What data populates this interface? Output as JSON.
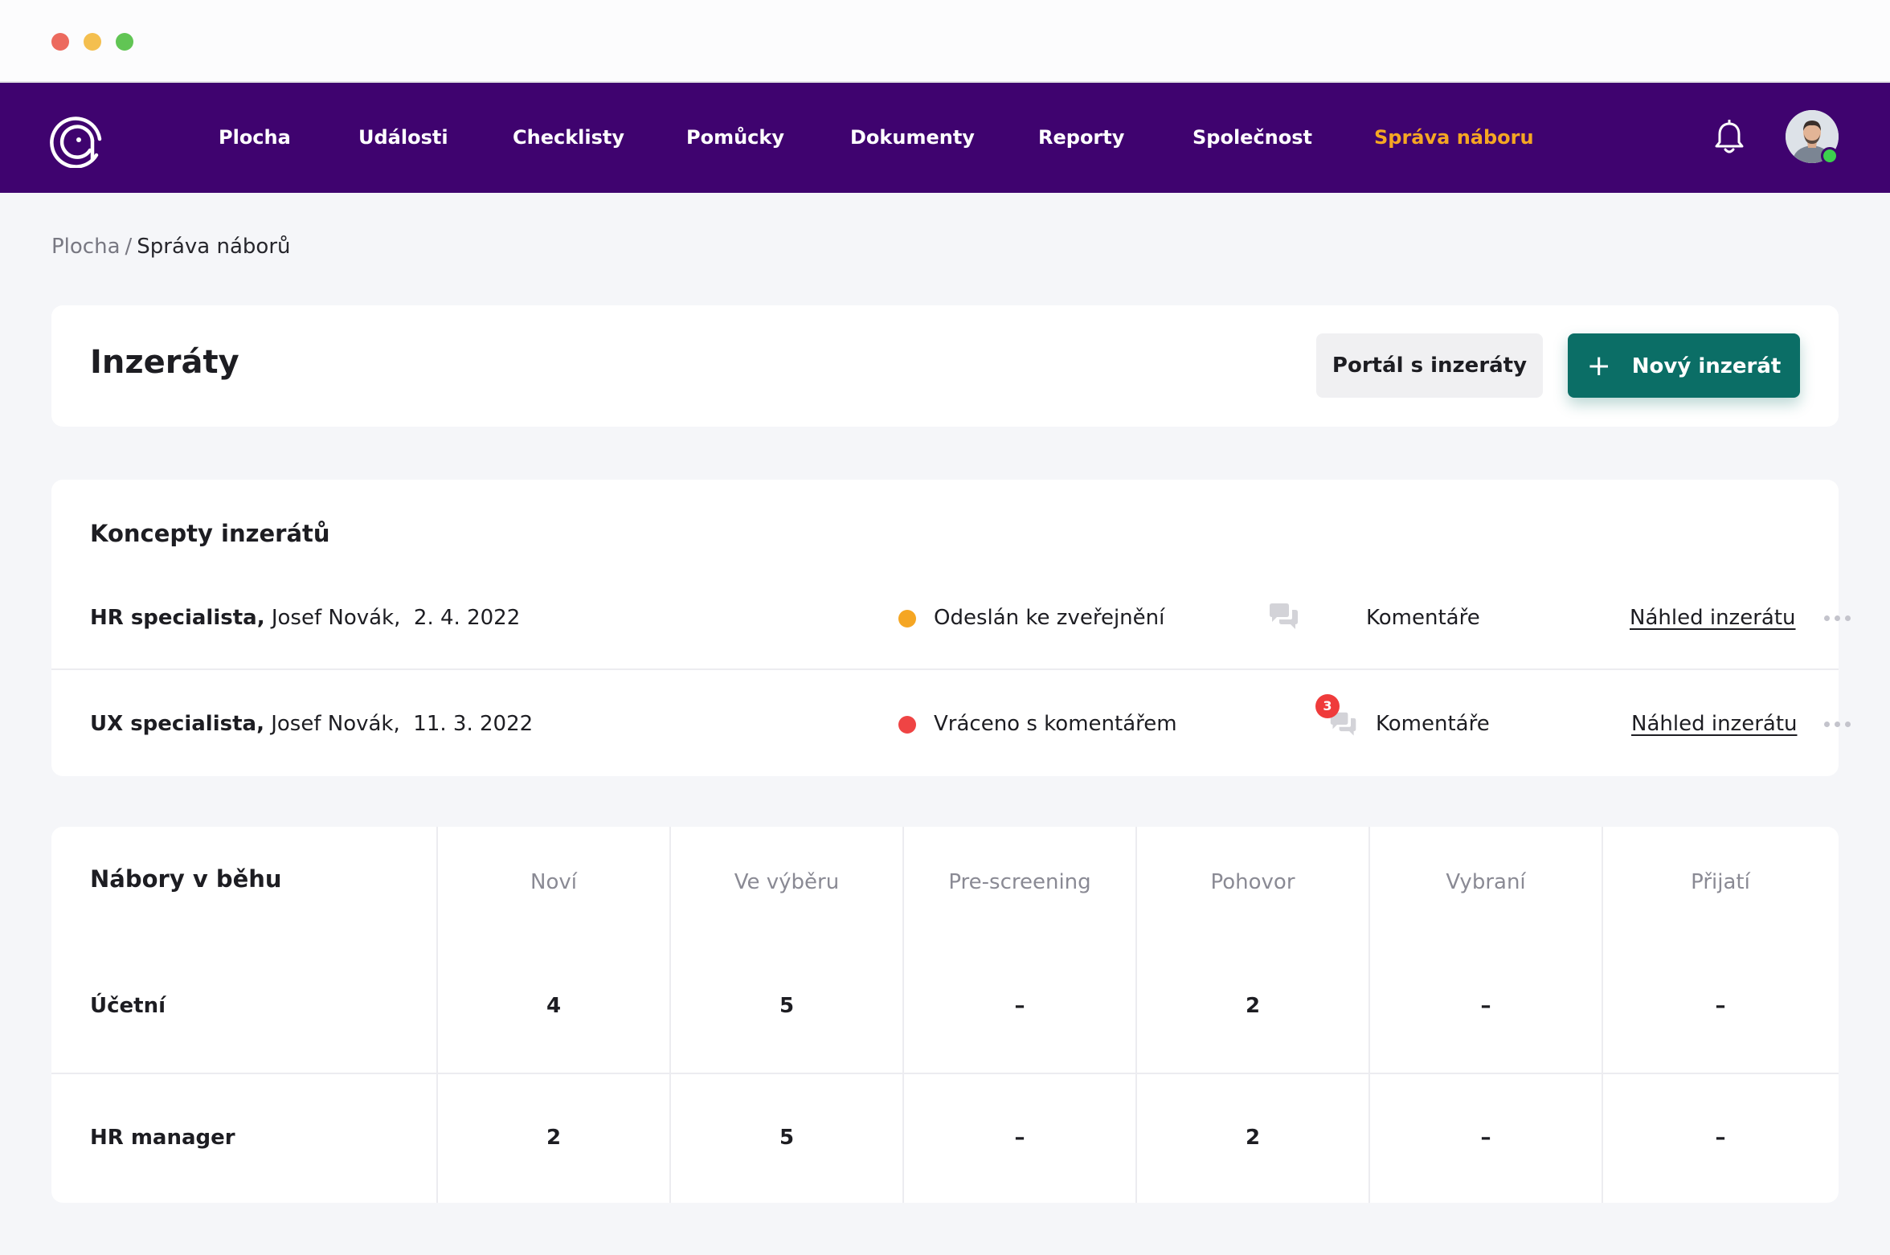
{
  "nav": {
    "items": [
      {
        "label": "Plocha"
      },
      {
        "label": "Události"
      },
      {
        "label": "Checklisty"
      },
      {
        "label": "Pomůcky"
      },
      {
        "label": "Dokumenty"
      },
      {
        "label": "Reporty"
      },
      {
        "label": "Společnost"
      },
      {
        "label": "Správa náboru",
        "active": true
      }
    ],
    "active_color": "#f5a623",
    "background_color": "#3f036f"
  },
  "breadcrumb": {
    "link": "Plocha",
    "separator": "/",
    "current": "Správa náborů"
  },
  "header": {
    "title": "Inzeráty",
    "portal_button": "Portál s inzeráty",
    "new_button": "Nový inzerát",
    "new_button_icon": "plus-icon",
    "accent_color": "#0b6e66"
  },
  "concepts": {
    "title": "Koncepty inzerátů",
    "rows": [
      {
        "position": "HR specialista,",
        "author": "Josef Novák,",
        "date": "2. 4. 2022",
        "status": "Odeslán ke zveřejnění",
        "status_color": "#f5a623",
        "comments_label": "Komentáře",
        "comments_count": null,
        "preview_label": "Náhled inzerátu"
      },
      {
        "position": "UX specialista,",
        "author": "Josef Novák,",
        "date": "11. 3. 2022",
        "status": "Vráceno s komentářem",
        "status_color": "#ef4444",
        "comments_label": "Komentáře",
        "comments_count": "3",
        "preview_label": "Náhled inzerátu"
      }
    ]
  },
  "recruitments": {
    "title": "Nábory v běhu",
    "columns": [
      "Noví",
      "Ve výběru",
      "Pre-screening",
      "Pohovor",
      "Vybraní",
      "Přijatí"
    ],
    "rows": [
      {
        "label": "Účetní",
        "values": [
          "4",
          "5",
          "–",
          "2",
          "–",
          "–"
        ]
      },
      {
        "label": "HR manager",
        "values": [
          "2",
          "5",
          "–",
          "2",
          "–",
          "–"
        ]
      }
    ]
  }
}
